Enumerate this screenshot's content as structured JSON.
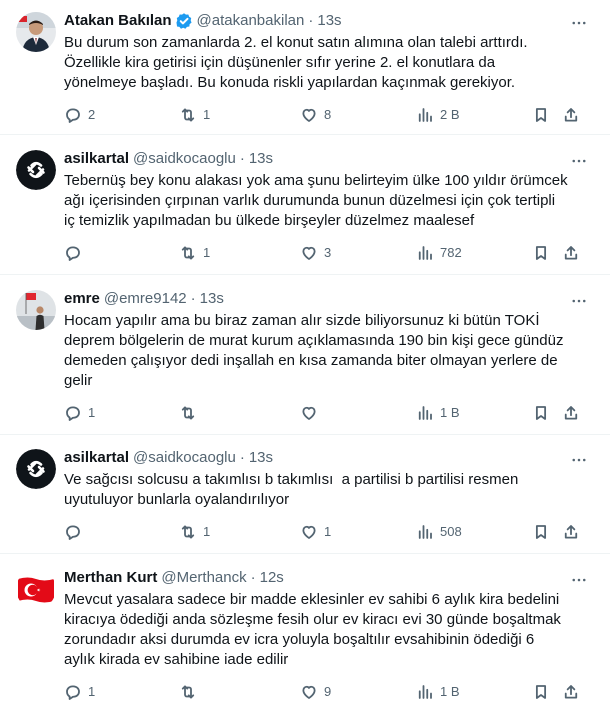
{
  "tweets": [
    {
      "name": "Atakan Bakılan",
      "verified": true,
      "handle": "@atakanbakilan",
      "time": "13s",
      "avatar": "photo-avatar-suit",
      "text": "Bu durum son zamanlarda 2. el konut satın alımına olan talebi arttırdı.\nÖzellikle kira getirisi için düşünenler sıfır yerine 2. el konutlara da\nyönelmeye başladı. Bu konuda riskli yapılardan kaçınmak gerekiyor.",
      "replies": "2",
      "retweets": "1",
      "likes": "8",
      "views": "2 B"
    },
    {
      "name": "asilkartal",
      "verified": false,
      "handle": "@saidkocaoglu",
      "time": "13s",
      "avatar": "black-logo-avatar",
      "text": "Tebernüş bey konu alakası yok ama şunu belirteyim ülke 100 yıldır örümcek\nağı içerisinden çırpınan varlık durumunda bunun düzelmesi için çok tertipli\niç temizlik yapılmadan bu ülkede birşeyler düzelmez maalesef",
      "replies": "",
      "retweets": "1",
      "likes": "3",
      "views": "782"
    },
    {
      "name": "emre",
      "verified": false,
      "handle": "@emre9142",
      "time": "13s",
      "avatar": "photo-avatar-flag",
      "text": "Hocam yapılır ama bu biraz zaman alır sizde biliyorsunuz ki bütün TOKİ\ndeprem bölgelerin de murat kurum açıklamasında 190 bin kişi gece gündüz\ndemeden çalışıyor dedi inşallah en kısa zamanda biter olmayan yerlere de\ngelir",
      "replies": "1",
      "retweets": "",
      "likes": "",
      "views": "1 B"
    },
    {
      "name": "asilkartal",
      "verified": false,
      "handle": "@saidkocaoglu",
      "time": "13s",
      "avatar": "black-logo-avatar",
      "text": "Ve sağcısı solcusu a takımlısı b takımlısı  a partilisi b partilisi resmen\nuyutuluyor bunlarla oyalandırılıyor",
      "replies": "",
      "retweets": "1",
      "likes": "1",
      "views": "508"
    },
    {
      "name": "Merthan Kurt",
      "verified": false,
      "handle": "@Merthanck",
      "time": "12s",
      "avatar": "turkish-flag-avatar",
      "text": "Mevcut yasalara sadece bir madde eklesinler ev sahibi 6 aylık kira bedelini\nkiracıya ödediği anda sözleşme fesih olur ev kiracı evi 30 günde boşaltmak\nzorundadır aksi durumda ev icra yoluyla boşaltılır evsahibinin ödediği 6\naylık kirada ev sahibine iade edilir",
      "replies": "1",
      "retweets": "",
      "likes": "9",
      "views": "1 B"
    }
  ],
  "colors": {
    "text": "#0f1419",
    "muted": "#536471",
    "verified": "#1d9bf0",
    "divider": "#eff3f4"
  },
  "icons": [
    "reply-icon",
    "retweet-icon",
    "like-icon",
    "views-icon",
    "bookmark-icon",
    "share-icon",
    "more-icon",
    "verified-badge-icon"
  ]
}
